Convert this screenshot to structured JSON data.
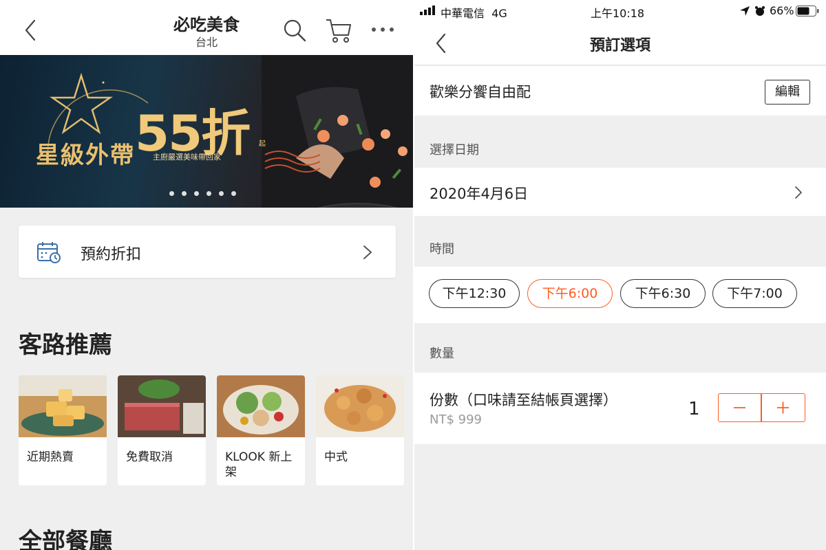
{
  "left": {
    "header": {
      "title": "必吃美食",
      "subtitle": "台北"
    },
    "banner": {
      "main_text": "星級外帶",
      "discount": "55折",
      "suffix": "起",
      "tagline": "主廚嚴選美味帶回家",
      "dot_count": 6
    },
    "promo": {
      "label": "預約折扣"
    },
    "section1": {
      "title": "客路推薦"
    },
    "cards": [
      {
        "label": "近期熱賣"
      },
      {
        "label": "免費取消"
      },
      {
        "label": "KLOOK 新上架"
      },
      {
        "label": "中式"
      }
    ],
    "section2": {
      "title": "全部餐廳"
    }
  },
  "right": {
    "status_bar": {
      "carrier": "中華電信",
      "network": "4G",
      "time": "上午10:18",
      "battery": "66%"
    },
    "nav": {
      "title": "預訂選項"
    },
    "package": {
      "name": "歡樂分饗自由配",
      "edit_label": "編輯"
    },
    "date_section": {
      "label": "選擇日期",
      "value": "2020年4月6日"
    },
    "time_section": {
      "label": "時間",
      "options": [
        {
          "label": "下午12:30",
          "selected": false
        },
        {
          "label": "下午6:00",
          "selected": true
        },
        {
          "label": "下午6:30",
          "selected": false
        },
        {
          "label": "下午7:00",
          "selected": false
        }
      ]
    },
    "quantity_section": {
      "label": "數量",
      "item_label": "份數（口味請至結帳頁選擇）",
      "price": "NT$ 999",
      "quantity": "1"
    }
  },
  "colors": {
    "accent": "#ff5b1f",
    "gold": "#f0c97a",
    "icon_blue": "#3b6ea8"
  }
}
